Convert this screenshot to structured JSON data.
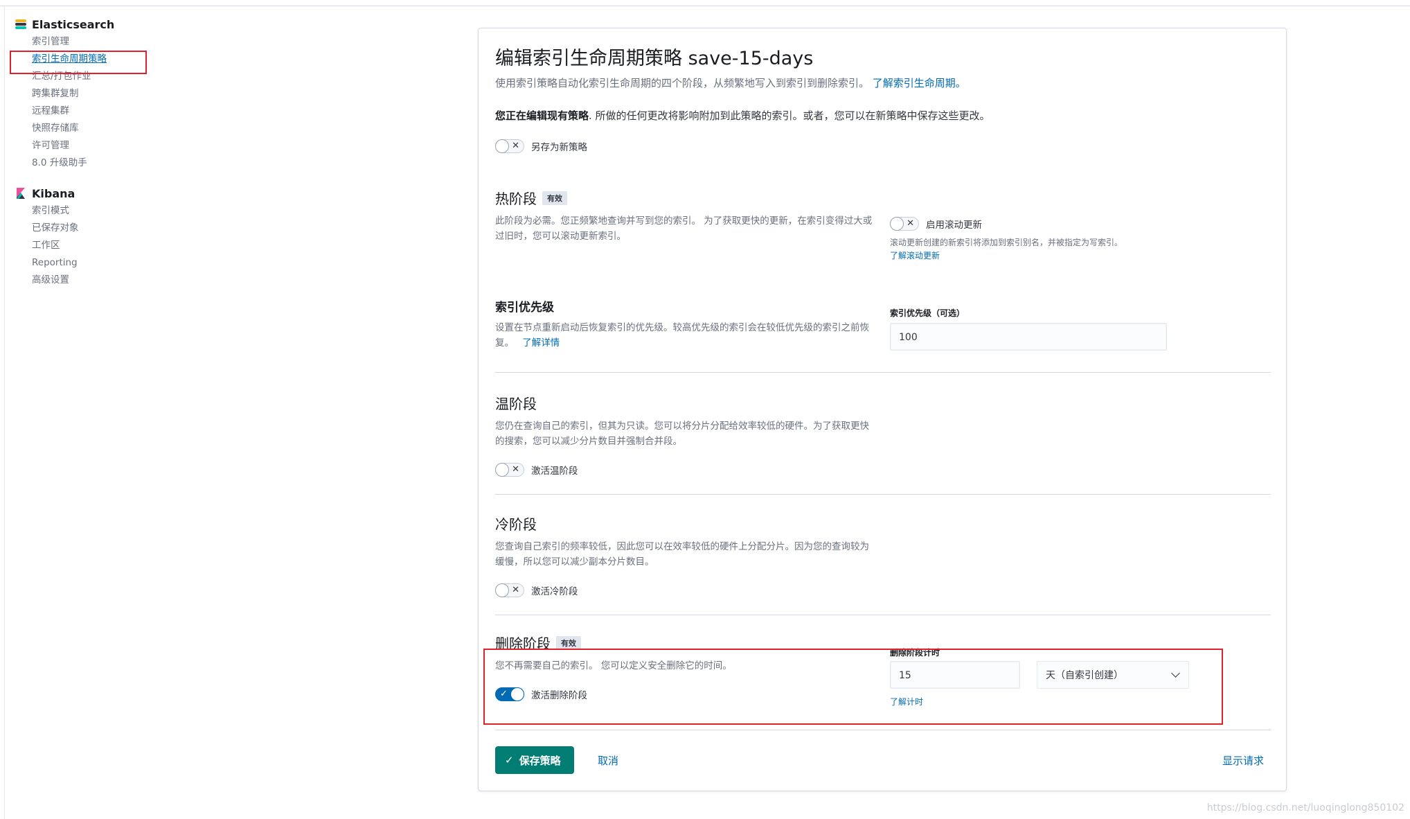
{
  "sidebar": {
    "elasticsearch": {
      "title": "Elasticsearch",
      "items": [
        "索引管理",
        "索引生命周期策略",
        "汇总/打包作业",
        "跨集群复制",
        "远程集群",
        "快照存储库",
        "许可管理",
        "8.0 升级助手"
      ],
      "active_index": 1
    },
    "kibana": {
      "title": "Kibana",
      "items": [
        "索引模式",
        "已保存对象",
        "工作区",
        "Reporting",
        "高级设置"
      ]
    }
  },
  "page": {
    "title": "编辑索引生命周期策略 save-15-days",
    "desc": "使用索引策略自动化索引生命周期的四个阶段，从频繁地写入到索引到删除索引。",
    "desc_link": "了解索引生命周期。",
    "notice_bold": "您正在编辑现有策略",
    "notice_text": ". 所做的任何更改将影响附加到此策略的索引。或者，您可以在新策略中保存这些更改。",
    "save_as_new_label": "另存为新策略"
  },
  "hot": {
    "title": "热阶段",
    "badge": "有效",
    "desc": "此阶段为必需。您正频繁地查询并写到您的索引。 为了获取更快的更新，在索引变得过大或过旧时，您可以滚动更新索引。",
    "rollover_label": "启用滚动更新",
    "rollover_help": "滚动更新创建的新索引将添加到索引别名，并被指定为写索引。",
    "rollover_link": "了解滚动更新"
  },
  "priority": {
    "title": "索引优先级",
    "desc": "设置在节点重新启动后恢复索引的优先级。较高优先级的索引会在较低优先级的索引之前恢复。",
    "desc_link": "了解详情",
    "field_label": "索引优先级（可选）",
    "value": "100"
  },
  "warm": {
    "title": "温阶段",
    "desc": "您仍在查询自己的索引，但其为只读。您可以将分片分配给效率较低的硬件。为了获取更快的搜索，您可以减少分片数目并强制合并段。",
    "activate_label": "激活温阶段"
  },
  "cold": {
    "title": "冷阶段",
    "desc": "您查询自己索引的频率较低，因此您可以在效率较低的硬件上分配分片。因为您的查询较为缓慢，所以您可以减少副本分片数目。",
    "activate_label": "激活冷阶段"
  },
  "delete": {
    "title": "删除阶段",
    "badge": "有效",
    "desc": "您不再需要自己的索引。 您可以定义安全删除它的时间。",
    "activate_label": "激活删除阶段",
    "timing_label": "删除阶段计时",
    "value": "15",
    "unit": "天（自索引创建）",
    "timing_link": "了解计时"
  },
  "footer": {
    "save_label": "保存策略",
    "cancel_label": "取消",
    "show_request_label": "显示请求"
  },
  "watermark": "https://blog.csdn.net/luoqinglong850102"
}
